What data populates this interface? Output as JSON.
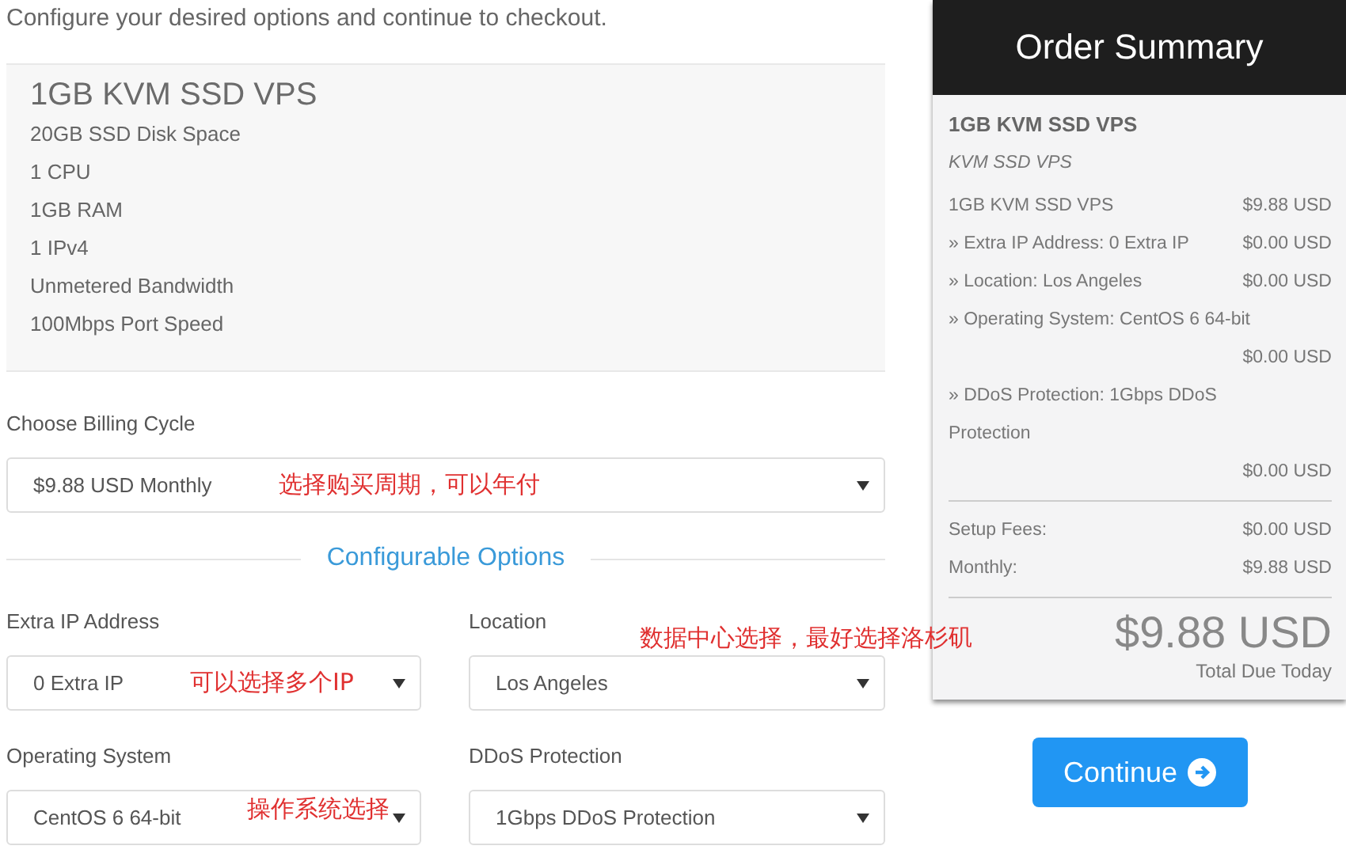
{
  "intro": "Configure your desired options and continue to checkout.",
  "product": {
    "name": "1GB KVM SSD VPS",
    "features": [
      "20GB SSD Disk Space",
      "1 CPU",
      "1GB RAM",
      "1 IPv4",
      "Unmetered Bandwidth",
      "100Mbps Port Speed"
    ]
  },
  "billing": {
    "label": "Choose Billing Cycle",
    "value": "$9.88 USD Monthly",
    "annotation": "选择购买周期，可以年付"
  },
  "section_heading": "Configurable Options",
  "options": [
    {
      "label": "Extra IP Address",
      "value": "0 Extra IP",
      "annotation": "可以选择多个IP"
    },
    {
      "label": "Location",
      "value": "Los Angeles",
      "annotation": "数据中心选择，最好选择洛杉矶"
    },
    {
      "label": "Operating System",
      "value": "CentOS 6 64-bit",
      "annotation": "操作系统选择"
    },
    {
      "label": "DDoS Protection",
      "value": "1Gbps DDoS Protection"
    }
  ],
  "summary": {
    "title": "Order Summary",
    "product_name": "1GB KVM SSD VPS",
    "product_group": "KVM SSD VPS",
    "lines": [
      {
        "label": "1GB KVM SSD VPS",
        "price": "$9.88 USD"
      },
      {
        "label": "» Extra IP Address: 0 Extra IP",
        "price": "$0.00 USD"
      },
      {
        "label": "» Location: Los Angeles",
        "price": "$0.00 USD"
      },
      {
        "label": "» Operating System: CentOS 6 64-bit",
        "price": "$0.00 USD"
      },
      {
        "label": "» DDoS Protection: 1Gbps DDoS Protection",
        "price": "$0.00 USD"
      }
    ],
    "fees": [
      {
        "label": "Setup Fees:",
        "price": "$0.00 USD"
      },
      {
        "label": "Monthly:",
        "price": "$9.88 USD"
      }
    ],
    "total": "$9.88 USD",
    "total_caption": "Total Due Today"
  },
  "continue_button": "Continue"
}
